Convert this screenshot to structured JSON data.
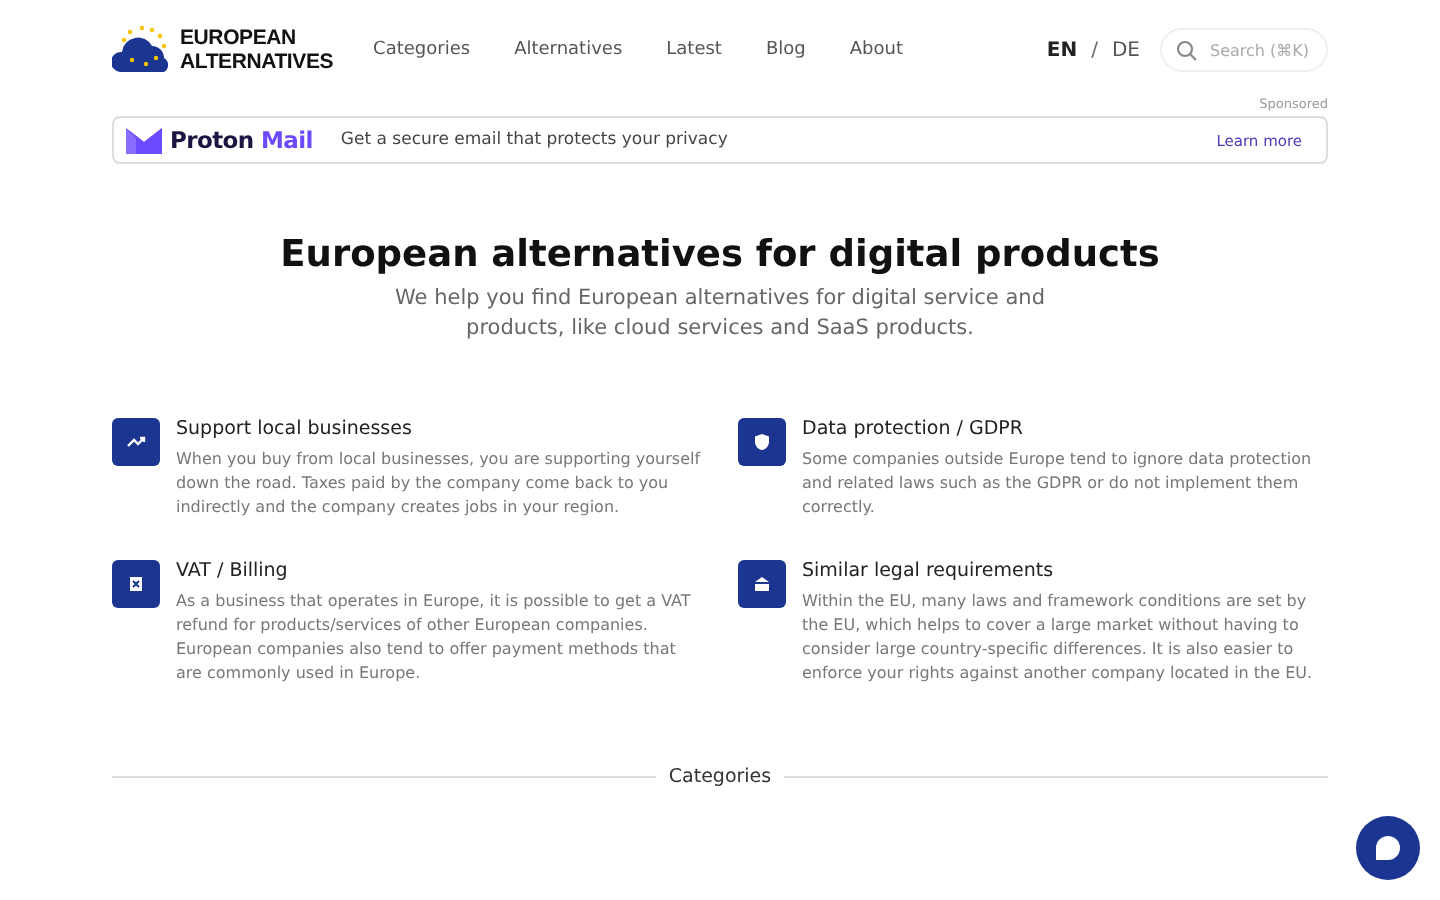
{
  "logo": {
    "line1": "EUROPEAN",
    "line2": "ALTERNATIVES"
  },
  "nav": [
    {
      "label": "Categories"
    },
    {
      "label": "Alternatives"
    },
    {
      "label": "Latest"
    },
    {
      "label": "Blog"
    },
    {
      "label": "About"
    }
  ],
  "languages": [
    {
      "label": "EN",
      "selected": true
    },
    {
      "label": "DE",
      "selected": false
    }
  ],
  "language_separator": "/",
  "search": {
    "placeholder": "Search (⌘K)"
  },
  "sponsor": {
    "label": "Sponsored",
    "brand_a": "Proton",
    "brand_b": "Mail",
    "text": "Get a secure email that protects your privacy",
    "link": "Learn more"
  },
  "hero": {
    "title": "European alternatives for digital products",
    "subtitle": "We help you find European alternatives for digital service and products, like cloud services and SaaS products."
  },
  "features": [
    {
      "kind": "trend",
      "title": "Support local businesses",
      "text": "When you buy from local businesses, you are supporting yourself down the road. Taxes paid by the company come back to you indirectly and the company creates jobs in your region."
    },
    {
      "kind": "shield",
      "title": "Data protection / GDPR",
      "text": "Some companies outside Europe tend to ignore data protection and related laws such as the GDPR or do not implement them correctly."
    },
    {
      "kind": "receipt",
      "title": "VAT / Billing",
      "text": "As a business that operates in Europe, it is possible to get a VAT refund for products/services of other European companies. European companies also tend to offer payment methods that are commonly used in Europe."
    },
    {
      "kind": "bank",
      "title": "Similar legal requirements",
      "text": "Within the EU, many laws and framework conditions are set by the EU, which helps to cover a large market without having to consider large country-specific differences. It is also easier to enforce your rights against another company located in the EU."
    }
  ],
  "section_heading": "Categories"
}
